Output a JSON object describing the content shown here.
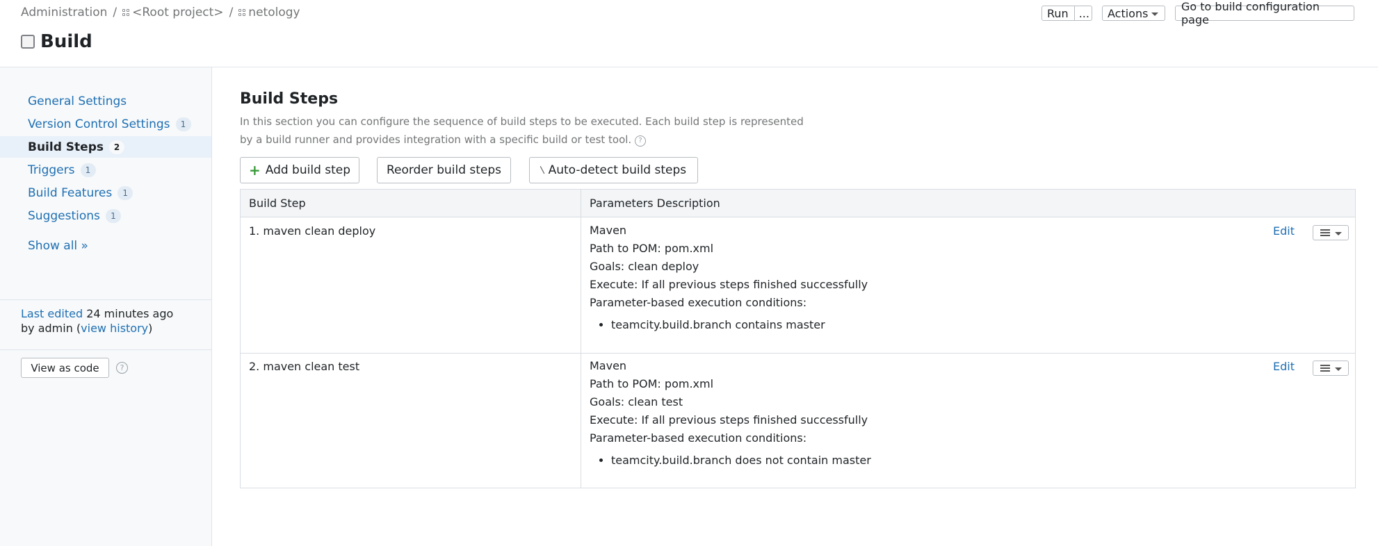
{
  "breadcrumb": {
    "root": "Administration",
    "separator": "/",
    "project": "<Root project>",
    "subproject": "netology"
  },
  "page": {
    "title": "Build"
  },
  "header_buttons": {
    "run": "Run",
    "run_more": "...",
    "actions": "Actions",
    "goto": "Go to build configuration page"
  },
  "sidebar": {
    "items": [
      {
        "label": "General Settings",
        "count": null
      },
      {
        "label": "Version Control Settings",
        "count": "1"
      },
      {
        "label": "Build Steps",
        "count": "2"
      },
      {
        "label": "Triggers",
        "count": "1"
      },
      {
        "label": "Build Features",
        "count": "1"
      },
      {
        "label": "Suggestions",
        "count": "1"
      }
    ],
    "active_index": 2,
    "show_all": "Show all »",
    "last_edited_label": "Last edited",
    "last_edited_time": " 24 minutes ago",
    "by_admin": "by admin  (",
    "view_history": "view history",
    "close_paren": ")",
    "view_as_code": "View as code",
    "help": "?"
  },
  "main": {
    "title": "Build Steps",
    "description": "In this section you can configure the sequence of build steps to be executed. Each build step is represented by a build runner and provides integration with a specific build or test tool.",
    "help": "?",
    "add_button": "Add build step",
    "add_plus": "+",
    "reorder_button": "Reorder build steps",
    "detect_button": "Auto-detect build steps",
    "table": {
      "col_step": "Build Step",
      "col_params": "Parameters Description",
      "edit_label": "Edit",
      "rows": [
        {
          "name": "1. maven clean deploy",
          "runner": "Maven",
          "pom": "Path to POM: pom.xml",
          "goals": "Goals: clean deploy",
          "execute": "Execute: If all previous steps finished successfully",
          "conditions_label": "Parameter-based execution conditions:",
          "condition": "teamcity.build.branch contains master"
        },
        {
          "name": "2. maven clean test",
          "runner": "Maven",
          "pom": "Path to POM: pom.xml",
          "goals": "Goals: clean test",
          "execute": "Execute: If all previous steps finished successfully",
          "conditions_label": "Parameter-based execution conditions:",
          "condition": "teamcity.build.branch does not contain master"
        }
      ]
    }
  },
  "colors": {
    "link": "#1e6fb3",
    "active_nav_bg": "#e8f0f9",
    "add_plus": "#3a9b3a"
  }
}
